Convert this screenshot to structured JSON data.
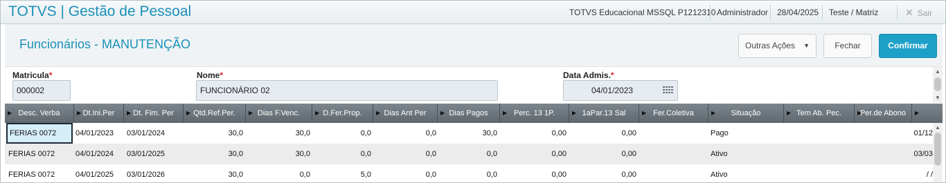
{
  "app": {
    "title": "TOTVS | Gestão de Pessoal",
    "environment": "TOTVS Educacional MSSQL P1212310",
    "user": "Administrador",
    "date": "28/04/2025",
    "branch": "Teste / Matriz",
    "exit_label": "Sair"
  },
  "page": {
    "title": "Funcionários - MANUTENÇÃO",
    "actions": {
      "more_label": "Outras Ações",
      "close_label": "Fechar",
      "confirm_label": "Confirmar"
    }
  },
  "form": {
    "matricula": {
      "label": "Matricula",
      "required_mark": "*",
      "value": "000002"
    },
    "nome": {
      "label": "Nome",
      "required_mark": "*",
      "value": "FUNCIONÁRIO 02"
    },
    "data_admis": {
      "label": "Data Admis.",
      "required_mark": "*",
      "value": "04/01/2023"
    }
  },
  "grid": {
    "columns": [
      "Desc. Verba",
      "Dt.Ini.Per",
      "Dt. Fim. Per",
      "Qtd.Ref.Per.",
      "Dias F.Venc.",
      "D.Fer.Prop.",
      "Dias Ant Per",
      "Dias Pagos",
      "Perc. 13 1P.",
      "1aPar.13 Sal",
      "Fer.Coletiva",
      "Situação",
      "Tem Ab. Pec.",
      "Per.de Abono"
    ],
    "rows": [
      {
        "desc": "FERIAS 0072",
        "ini": "04/01/2023",
        "fim": "03/01/2024",
        "qtd": "30,0",
        "venc": "30,0",
        "prop": "0,0",
        "ant": "0,0",
        "pagos": "30,0",
        "perc": "0,00",
        "par13": "0,00",
        "colet": "",
        "sit": "Pago",
        "abpec": "",
        "abono": "01/12"
      },
      {
        "desc": "FERIAS 0072",
        "ini": "04/01/2024",
        "fim": "03/01/2025",
        "qtd": "30,0",
        "venc": "30,0",
        "prop": "0,0",
        "ant": "0,0",
        "pagos": "0,0",
        "perc": "0,00",
        "par13": "0,00",
        "colet": "",
        "sit": "Ativo",
        "abpec": "",
        "abono": "03/03"
      },
      {
        "desc": "FERIAS 0072",
        "ini": "04/01/2025",
        "fim": "03/01/2026",
        "qtd": "30,0",
        "venc": "0,0",
        "prop": "5,0",
        "ant": "0,0",
        "pagos": "0,0",
        "perc": "0,00",
        "par13": "0,00",
        "colet": "",
        "sit": "Ativo",
        "abpec": "",
        "abono": "/ /"
      }
    ]
  },
  "icons": {
    "close": "close-icon",
    "calendar": "calendar-icon",
    "dropdown": "chevron-down-icon",
    "column_marker": "triangle-right-icon"
  },
  "colors": {
    "brand": "#1a90b9",
    "primary_button": "#1ea1c9",
    "grid_header": "#6b747a",
    "required": "#e02020"
  }
}
